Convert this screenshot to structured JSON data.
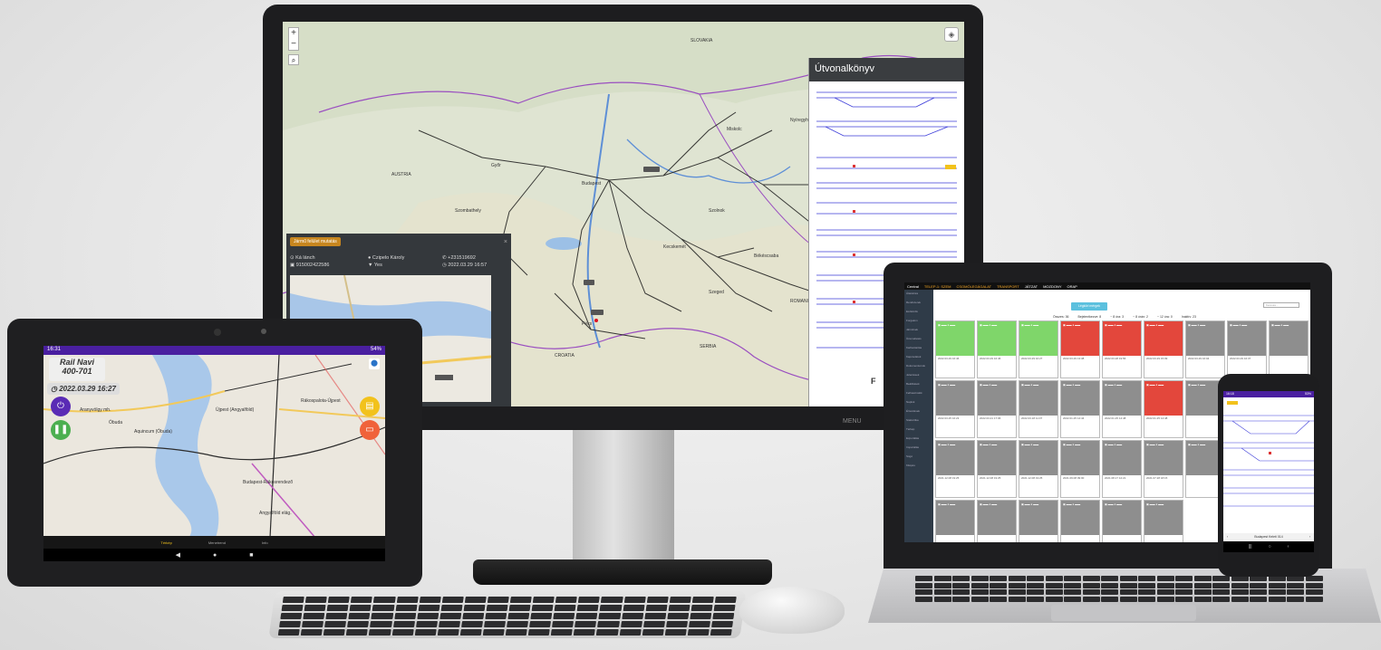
{
  "colors": {
    "purple": "#4a1fa0",
    "green_card": "#7fd66a",
    "red_card": "#e3473c",
    "grey_card": "#8e8e8e",
    "orange_btn": "#f0623a",
    "yellow_btn": "#f2c21c",
    "power_btn": "#5a2bb5",
    "play_btn": "#4caf50"
  },
  "monitor": {
    "label": "MENU",
    "map": {
      "zoom_in": "+",
      "zoom_out": "−",
      "search_icon": "search-icon",
      "layers_icon": "layers-icon",
      "places": [
        {
          "name": "SLOVAKIA"
        },
        {
          "name": "AUSTRIA"
        },
        {
          "name": "Budapest"
        },
        {
          "name": "Miskolc"
        },
        {
          "name": "Debrecen"
        },
        {
          "name": "Szeged"
        },
        {
          "name": "Pécs"
        },
        {
          "name": "Szombathely"
        },
        {
          "name": "Győr"
        },
        {
          "name": "Kecskemét"
        },
        {
          "name": "Szolnok"
        },
        {
          "name": "CROATIA"
        },
        {
          "name": "SERBIA"
        },
        {
          "name": "ROMANIA"
        },
        {
          "name": "Nyíregyháza"
        },
        {
          "name": "Békéscsaba"
        }
      ]
    },
    "route_panel": {
      "title": "Útvonalkönyv"
    },
    "vehicle_popup": {
      "tag": "Jármű felület mutatás",
      "close": "×",
      "fields": {
        "name": "Ká lánch",
        "driver": "Czipelo Károly",
        "phone": "+231519692",
        "id": "915002422586",
        "signal": "Yes",
        "timestamp": "2022.03.29 16:57"
      }
    }
  },
  "tablet": {
    "status_time": "16:31",
    "status_right": "54%",
    "title_line1": "Rail Navi",
    "title_line2": "400-701",
    "date": "2022.03.29 16:27",
    "map_labels": [
      "Aranyvölgy mh.",
      "Óbuda",
      "Aquincum (Óbuda)",
      "Újpest (Angyalföld)",
      "Rákospalota-Újpest",
      "Budapest-Rákosrendező",
      "Angyalföld elág."
    ],
    "tabs": [
      "Térkép",
      "Menetrend",
      "Info"
    ],
    "sys_back": "◀",
    "sys_home": "●",
    "sys_recent": "■"
  },
  "laptop": {
    "top_bar": [
      "Central",
      "TELEP-1: SZEM",
      "CSOMÓLEGÁGALAT",
      "TRANSPORT",
      "JÁTZAT",
      "MOZDONY",
      "ORAP"
    ],
    "sidebar": [
      "Áttekintés",
      "Rendszerek",
      "Eszközök",
      "Forgalom",
      "Járművek",
      "Üzemeltetés",
      "Karbantartás",
      "Kapcsolatok",
      "Dokumentumok",
      "Jelentések",
      "Beállítások",
      "Felhasználók",
      "Naplók",
      "Értesítések",
      "Statisztika",
      "Térkép",
      "Exportálás",
      "Importálás",
      "Súgó",
      "Kilépés"
    ],
    "primary_button": "Légköri mérgek",
    "search_placeholder": "Keresés...",
    "stats": [
      "Összes: 36",
      "Bejelentkezve: 8",
      "~ 8 óra: 3",
      "~ 8 órán: 2",
      "~ 12 óra: 0",
      "Inaktív: 23"
    ],
    "cards": [
      {
        "status": "green",
        "date": "2022.03.29 16:46"
      },
      {
        "status": "green",
        "date": "2022.03.29 16:46"
      },
      {
        "status": "green",
        "date": "2022.03.29 16:27"
      },
      {
        "status": "red",
        "date": "2022.03.29 13:38"
      },
      {
        "status": "red",
        "date": "2022.03.28 19:56"
      },
      {
        "status": "red",
        "date": "2022.03.29 15:09"
      },
      {
        "status": "grey",
        "date": "2022.03.29 16:04"
      },
      {
        "status": "grey",
        "date": "2022.03.29 16:37"
      },
      {
        "status": "grey",
        "date": ""
      },
      {
        "status": "grey",
        "date": "2022.03.25 16:23"
      },
      {
        "status": "grey",
        "date": "2022.03.21 17:06"
      },
      {
        "status": "grey",
        "date": "2022.03.18 11:07"
      },
      {
        "status": "grey",
        "date": "2022.01.25 14:44"
      },
      {
        "status": "grey",
        "date": "2022.01.25 14:48"
      },
      {
        "status": "red",
        "date": "2022.01.25 14:48"
      },
      {
        "status": "grey",
        "date": ""
      },
      {
        "status": "grey",
        "date": ""
      },
      {
        "status": "grey",
        "date": ""
      },
      {
        "status": "grey",
        "date": "2021.12.08 19:25"
      },
      {
        "status": "grey",
        "date": "2021.12.08 19:25"
      },
      {
        "status": "grey",
        "date": "2021.12.08 19:25"
      },
      {
        "status": "grey",
        "date": "2021.09.08 09:00"
      },
      {
        "status": "grey",
        "date": "2021.08.17 12:21"
      },
      {
        "status": "grey",
        "date": "2021.07.28 18:15"
      },
      {
        "status": "grey",
        "date": ""
      },
      {
        "status": "grey",
        "date": ""
      },
      {
        "status": "grey",
        "date": ""
      },
      {
        "status": "grey",
        "date": ""
      },
      {
        "status": "grey",
        "date": ""
      },
      {
        "status": "grey",
        "date": ""
      },
      {
        "status": "grey",
        "date": ""
      },
      {
        "status": "grey",
        "date": ""
      },
      {
        "status": "grey",
        "date": ""
      }
    ]
  },
  "phone": {
    "status_time": "16:18",
    "status_right": "53%",
    "bottom_label": "Budapest Keleti 014"
  }
}
